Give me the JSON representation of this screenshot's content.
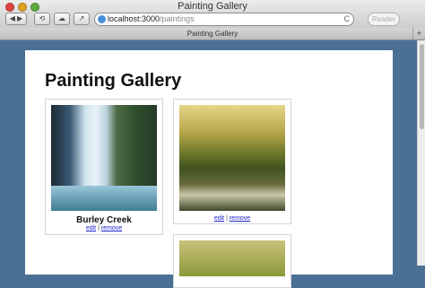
{
  "window": {
    "title": "Painting Gallery"
  },
  "toolbar": {
    "back_fwd": "◀ ▶",
    "address": {
      "host": "localhost:3000",
      "path": "/paintings"
    },
    "reload": "C",
    "reader": "Reader"
  },
  "tab": {
    "label": "Painting Gallery",
    "add": "+"
  },
  "page": {
    "title": "Painting Gallery",
    "paintings": [
      {
        "name": "Burley Creek",
        "edit": "edit",
        "sep": "|",
        "remove": "remove"
      },
      {
        "name": "",
        "edit": "edit",
        "sep": "|",
        "remove": "remove"
      }
    ]
  }
}
